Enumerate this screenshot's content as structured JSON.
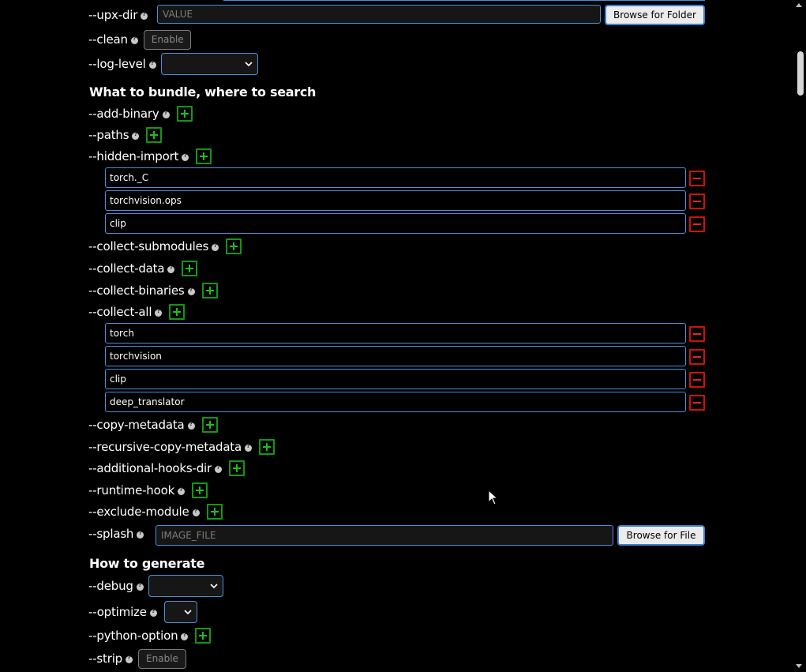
{
  "general": {
    "upx_dir": {
      "label": "--upx-dir",
      "placeholder": "VALUE",
      "browse_label": "Browse for Folder"
    },
    "clean": {
      "label": "--clean",
      "button": "Enable"
    },
    "log_level": {
      "label": "--log-level",
      "value": ""
    }
  },
  "bundle": {
    "heading": "What to bundle, where to search",
    "add_binary": "--add-binary",
    "paths": "--paths",
    "hidden_import": {
      "label": "--hidden-import",
      "entries": [
        "torch._C",
        "torchvision.ops",
        "clip"
      ]
    },
    "collect_submodules": "--collect-submodules",
    "collect_data": "--collect-data",
    "collect_binaries": "--collect-binaries",
    "collect_all": {
      "label": "--collect-all",
      "entries": [
        "torch",
        "torchvision",
        "clip",
        "deep_translator"
      ]
    },
    "copy_metadata": "--copy-metadata",
    "recursive_copy_metadata": "--recursive-copy-metadata",
    "additional_hooks_dir": "--additional-hooks-dir",
    "runtime_hook": "--runtime-hook",
    "exclude_module": "--exclude-module",
    "splash": {
      "label": "--splash",
      "placeholder": "IMAGE_FILE",
      "browse_label": "Browse for File"
    }
  },
  "generate": {
    "heading": "How to generate",
    "debug": {
      "label": "--debug",
      "value": ""
    },
    "optimize": {
      "label": "--optimize",
      "value": ""
    },
    "python_option": "--python-option",
    "strip": {
      "label": "--strip",
      "button": "Enable"
    }
  },
  "colors": {
    "add": "#119911",
    "remove": "#cc1111",
    "input_border": "#4a8fd8",
    "background": "#000000"
  }
}
